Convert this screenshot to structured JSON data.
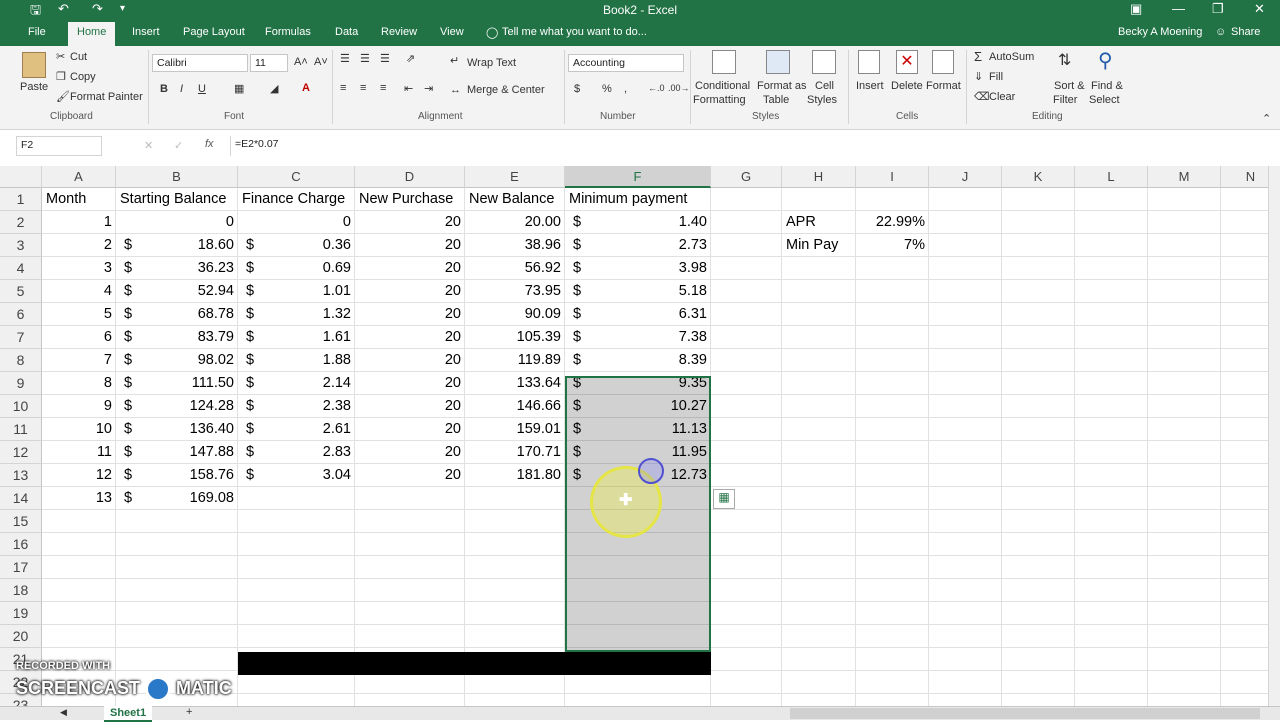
{
  "window": {
    "title": "Book2 - Excel"
  },
  "menu": {
    "file": "File",
    "tabs": [
      "Home",
      "Insert",
      "Page Layout",
      "Formulas",
      "Data",
      "Review",
      "View"
    ],
    "tell_me": "Tell me what you want to do...",
    "user": "Becky A Moening",
    "share": "Share"
  },
  "ribbon": {
    "clipboard": {
      "paste": "Paste",
      "cut": "Cut",
      "copy": "Copy",
      "format_painter": "Format Painter",
      "label": "Clipboard"
    },
    "font": {
      "name": "Calibri",
      "size": "11",
      "label": "Font",
      "bold": "B",
      "italic": "I",
      "underline": "U"
    },
    "alignment": {
      "wrap": "Wrap Text",
      "merge": "Merge & Center",
      "label": "Alignment"
    },
    "number": {
      "format": "Accounting",
      "currency": "$",
      "percent": "%",
      "comma": ",",
      "label": "Number"
    },
    "styles": {
      "conditional": "Conditional",
      "conditional2": "Formatting",
      "format_table": "Format as",
      "format_table2": "Table",
      "cell_styles": "Cell",
      "cell_styles2": "Styles",
      "label": "Styles"
    },
    "cells": {
      "insert": "Insert",
      "delete": "Delete",
      "format": "Format",
      "label": "Cells"
    },
    "editing": {
      "autosum": "AutoSum",
      "fill": "Fill",
      "clear": "Clear",
      "sort": "Sort &",
      "sort2": "Filter",
      "find": "Find &",
      "find2": "Select",
      "label": "Editing"
    }
  },
  "formula_bar": {
    "name_box": "F2",
    "fx": "fx",
    "formula": "=E2*0.07"
  },
  "columns": [
    "A",
    "B",
    "C",
    "D",
    "E",
    "F",
    "G",
    "H",
    "I",
    "J",
    "K",
    "L",
    "M",
    "N"
  ],
  "rows": [
    "1",
    "2",
    "3",
    "4",
    "5",
    "6",
    "7",
    "8",
    "9",
    "10",
    "11",
    "12",
    "13",
    "14",
    "15",
    "16",
    "17",
    "18",
    "19",
    "20",
    "21",
    "22",
    "23"
  ],
  "headers": {
    "A": "Month",
    "B": "Starting Balance",
    "C": "Finance Charge",
    "D": "New Purchase",
    "E": "New Balance",
    "F": "Minimum payment"
  },
  "table": [
    {
      "A": "1",
      "B": "0",
      "C": "0",
      "D": "20",
      "E": "20.00",
      "F": "1.40"
    },
    {
      "A": "2",
      "B": "18.60",
      "C": "0.36",
      "D": "20",
      "E": "38.96",
      "F": "2.73"
    },
    {
      "A": "3",
      "B": "36.23",
      "C": "0.69",
      "D": "20",
      "E": "56.92",
      "F": "3.98"
    },
    {
      "A": "4",
      "B": "52.94",
      "C": "1.01",
      "D": "20",
      "E": "73.95",
      "F": "5.18"
    },
    {
      "A": "5",
      "B": "68.78",
      "C": "1.32",
      "D": "20",
      "E": "90.09",
      "F": "6.31"
    },
    {
      "A": "6",
      "B": "83.79",
      "C": "1.61",
      "D": "20",
      "E": "105.39",
      "F": "7.38"
    },
    {
      "A": "7",
      "B": "98.02",
      "C": "1.88",
      "D": "20",
      "E": "119.89",
      "F": "8.39"
    },
    {
      "A": "8",
      "B": "111.50",
      "C": "2.14",
      "D": "20",
      "E": "133.64",
      "F": "9.35"
    },
    {
      "A": "9",
      "B": "124.28",
      "C": "2.38",
      "D": "20",
      "E": "146.66",
      "F": "10.27"
    },
    {
      "A": "10",
      "B": "136.40",
      "C": "2.61",
      "D": "20",
      "E": "159.01",
      "F": "11.13"
    },
    {
      "A": "11",
      "B": "147.88",
      "C": "2.83",
      "D": "20",
      "E": "170.71",
      "F": "11.95"
    },
    {
      "A": "12",
      "B": "158.76",
      "C": "3.04",
      "D": "20",
      "E": "181.80",
      "F": "12.73"
    },
    {
      "A": "13",
      "B": "169.08",
      "C": "",
      "D": "",
      "E": "",
      "F": ""
    }
  ],
  "side": {
    "apr_label": "APR",
    "apr_value": "22.99%",
    "minpay_label": "Min Pay",
    "minpay_value": "7%"
  },
  "currency_symbol": "$",
  "sheet": {
    "tab": "Sheet1",
    "add": "+"
  },
  "watermark": {
    "line1": "RECORDED WITH",
    "line2": "SCREENCAST",
    "line3": "MATIC"
  },
  "colors": {
    "excel_green": "#217346"
  }
}
